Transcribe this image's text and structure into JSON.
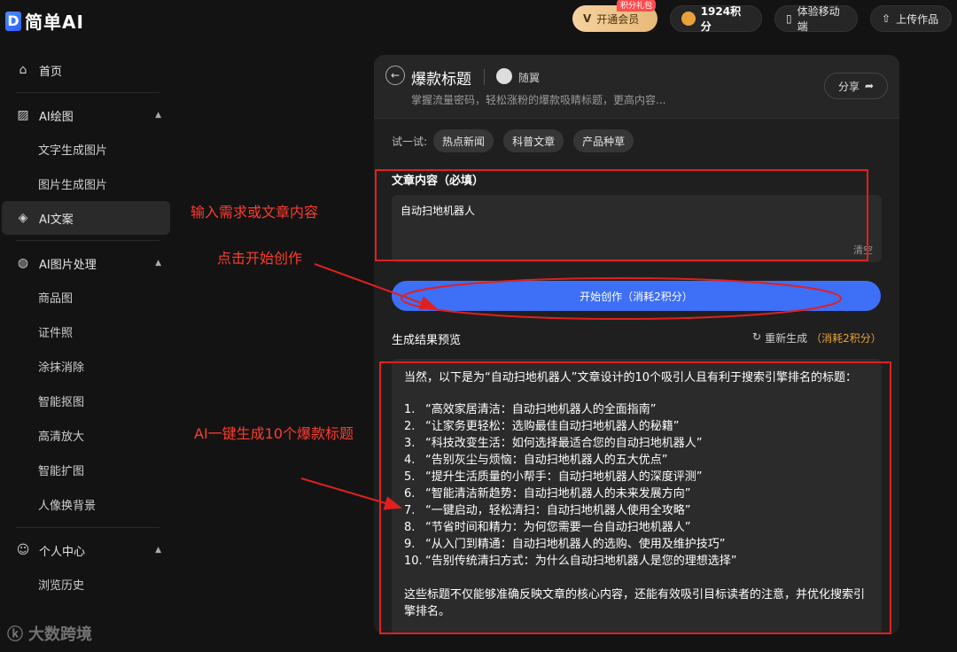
{
  "app": {
    "logo_mark": "D",
    "logo_text": "简单AI"
  },
  "topbar": {
    "vip_label": "开通会员",
    "vip_badge": "积分礼包",
    "points_label": "1924积分",
    "mobile_label": "体验移动端",
    "upload_label": "上传作品"
  },
  "sidebar": {
    "home": "首页",
    "ai_draw": {
      "label": "AI绘图",
      "items": [
        "文字生成图片",
        "图片生成图片"
      ]
    },
    "ai_copy": "AI文案",
    "ai_image": {
      "label": "AI图片处理",
      "items": [
        "商品图",
        "证件照",
        "涂抹消除",
        "智能抠图",
        "高清放大",
        "智能扩图",
        "人像换背景"
      ]
    },
    "personal": {
      "label": "个人中心",
      "items": [
        "浏览历史"
      ]
    }
  },
  "watermark": "大数跨境",
  "tool": {
    "title": "爆款标题",
    "author": "随翼",
    "description": "掌握流量密码，轻松涨粉的爆款吸睛标题，更高内容...",
    "share": "分享",
    "try_label": "试一试:",
    "chips": [
      "热点新闻",
      "科普文章",
      "产品种草"
    ],
    "content_label": "文章内容（必填）",
    "content_value": "自动扫地机器人",
    "clear": "清空",
    "start_button": "开始创作（消耗2积分）",
    "preview_label": "生成结果预览",
    "regenerate": "重新生成",
    "regenerate_cost": "（消耗2积分）"
  },
  "result": {
    "intro": "当然，以下是为“自动扫地机器人”文章设计的10个吸引人且有利于搜索引擎排名的标题：",
    "items": [
      "“高效家居清洁：自动扫地机器人的全面指南”",
      "“让家务更轻松：选购最佳自动扫地机器人的秘籍”",
      "“科技改变生活：如何选择最适合您的自动扫地机器人”",
      "“告别灰尘与烦恼：自动扫地机器人的五大优点”",
      "“提升生活质量的小帮手：自动扫地机器人的深度评测”",
      "“智能清洁新趋势：自动扫地机器人的未来发展方向”",
      "“一键启动，轻松清扫：自动扫地机器人使用全攻略”",
      "“节省时间和精力：为何您需要一台自动扫地机器人”",
      "“从入门到精通：自动扫地机器人的选购、使用及维护技巧”",
      "“告别传统清扫方式：为什么自动扫地机器人是您的理想选择”"
    ],
    "outro": "这些标题不仅能够准确反映文章的核心内容，还能有效吸引目标读者的注意，并优化搜索引擎排名。"
  },
  "annotations": {
    "input": "输入需求或文章内容",
    "start": "点击开始创作",
    "generate": "AI一键生成10个爆款标题",
    "color": "#ff3b2f"
  }
}
